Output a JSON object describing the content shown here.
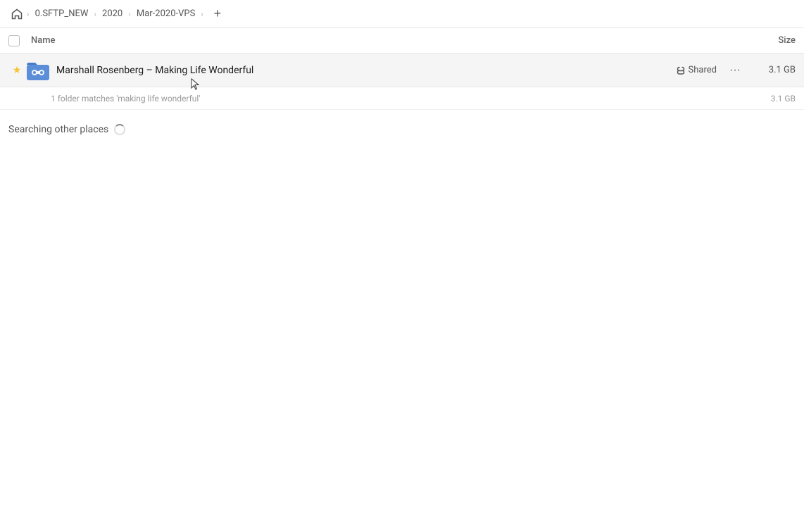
{
  "breadcrumb": {
    "home_label": "Home",
    "items": [
      {
        "label": "0.SFTP_NEW"
      },
      {
        "label": "2020"
      },
      {
        "label": "Mar-2020-VPS"
      }
    ],
    "add_label": "+"
  },
  "columns": {
    "name_label": "Name",
    "size_label": "Size"
  },
  "file_row": {
    "name": "Marshall Rosenberg – Making Life Wonderful",
    "shared_label": "Shared",
    "size": "3.1 GB",
    "more_label": "···"
  },
  "match_info": {
    "text": "1 folder matches 'making life wonderful'",
    "size": "3.1 GB"
  },
  "searching": {
    "text": "Searching other places"
  }
}
